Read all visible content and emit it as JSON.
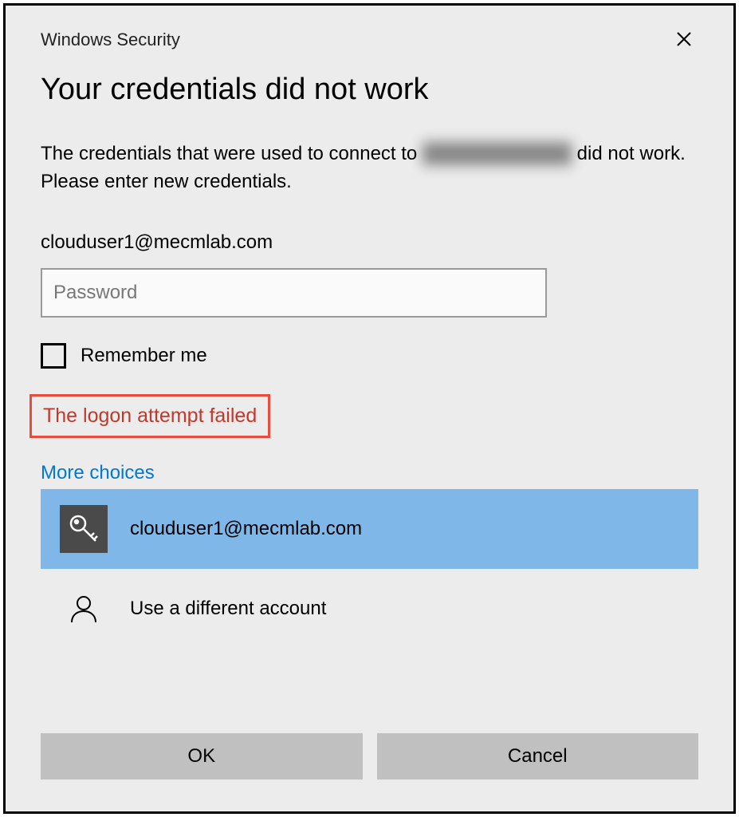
{
  "window": {
    "title": "Windows Security"
  },
  "heading": "Your credentials did not work",
  "description": {
    "prefix": "The credentials that were used to connect to ",
    "redacted": "███████████",
    "suffix": " did not work. Please enter new credentials."
  },
  "username": "clouduser1@mecmlab.com",
  "password": {
    "placeholder": "Password",
    "value": ""
  },
  "remember": {
    "label": "Remember me",
    "checked": false
  },
  "error": "The logon attempt failed",
  "moreChoices": "More choices",
  "accounts": [
    {
      "label": "clouduser1@mecmlab.com",
      "icon": "key",
      "selected": true
    },
    {
      "label": "Use a different account",
      "icon": "user",
      "selected": false
    }
  ],
  "buttons": {
    "ok": "OK",
    "cancel": "Cancel"
  }
}
